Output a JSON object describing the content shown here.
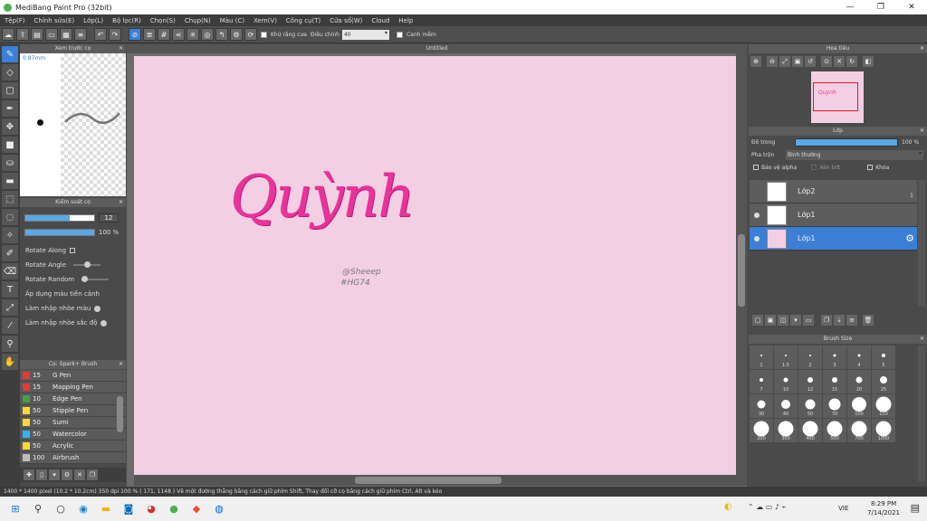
{
  "window": {
    "title": "MediBang Paint Pro (32bit)"
  },
  "menu": [
    "Tệp(F)",
    "Chỉnh sửa(E)",
    "Lớp(L)",
    "Bộ lọc(R)",
    "Chọn(S)",
    "Chụp(N)",
    "Màu (C)",
    "Xem(V)",
    "Công cụ(T)",
    "Cửa sổ(W)",
    "Cloud",
    "Help"
  ],
  "toolbar": {
    "antialias_label": "Khử răng cưa",
    "adjust_label": "Điều chỉnh",
    "adjust_value": "40",
    "snap_label": "Canh mềm"
  },
  "preview": {
    "title": "Xem trước cọ",
    "size": "0.87mm"
  },
  "brush_control": {
    "title": "Kiểm soát cọ",
    "size_value": "12",
    "opacity_value": "100 %",
    "size_fraction": 0.65,
    "opacity_fraction": 1.0,
    "options": [
      {
        "label": "Rotate Along"
      },
      {
        "label": "Rotate Angle"
      },
      {
        "label": "Rotate Random"
      },
      {
        "label": "Áp dụng màu tiền cảnh"
      },
      {
        "label": "Làm nhập nhòe màu"
      },
      {
        "label": "Làm nhập nhòe sắc độ"
      }
    ]
  },
  "brush_list": {
    "title": "Cọ: Spark+ Brush",
    "items": [
      {
        "size": "15",
        "name": "G Pen",
        "color": "#e53935"
      },
      {
        "size": "15",
        "name": "Mapping Pen",
        "color": "#e53935"
      },
      {
        "size": "10",
        "name": "Edge Pen",
        "color": "#43a047"
      },
      {
        "size": "50",
        "name": "Stipple Pen",
        "color": "#fdd835"
      },
      {
        "size": "50",
        "name": "Sumi",
        "color": "#fdd835"
      },
      {
        "size": "50",
        "name": "Watercolor",
        "color": "#29b6f6"
      },
      {
        "size": "50",
        "name": "Acrylic",
        "color": "#fdd835"
      },
      {
        "size": "100",
        "name": "Airbrush",
        "color": "#bdbdbd"
      }
    ]
  },
  "canvas": {
    "title": "Untitled",
    "art_text": "Quỳnh",
    "signature_1": "@Sheeep",
    "signature_2": "#HG74"
  },
  "navigator": {
    "title": "Hoa tiêu",
    "thumb_text": "Quỳnh"
  },
  "layer": {
    "title": "Lớp",
    "opacity_label": "Độ trong",
    "opacity_value": "100 %",
    "opacity_fraction": 1.0,
    "blend_label": "Pha trộn",
    "blend_value": "Bình thường",
    "protect_alpha": "Bảo vệ alpha",
    "clipping": "Xén bớt",
    "lock": "Khóa",
    "badge": "1",
    "layers": [
      {
        "name": "Lớp2",
        "selected": false
      },
      {
        "name": "Lớp1",
        "selected": false
      },
      {
        "name": "Lớp1",
        "selected": true
      }
    ]
  },
  "brush_size": {
    "title": "Brush Size",
    "sizes": [
      "1",
      "1.5",
      "2",
      "3",
      "4",
      "5",
      "7",
      "10",
      "12",
      "15",
      "20",
      "25",
      "30",
      "40",
      "50",
      "70",
      "100",
      "150",
      "200",
      "300",
      "400",
      "500",
      "700",
      "1000"
    ]
  },
  "status": {
    "text": "1400 * 1400 pixel   (10.2 * 10.2cm)   350 dpi   100 %   ( 171, 1148 )   Vẽ một đường thẳng bằng cách giữ phím Shift, Thay đổi cỡ cọ bằng cách giữ phím Ctrl, Alt và kéo"
  },
  "taskbar": {
    "time": "8:29 PM",
    "date": "7/14/2021",
    "lang": "VIE"
  }
}
